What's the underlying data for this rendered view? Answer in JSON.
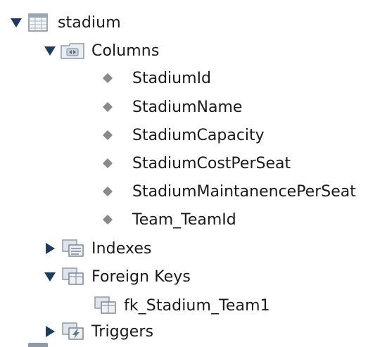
{
  "table": {
    "name": "stadium",
    "icon": "table-icon",
    "expanded": true
  },
  "groups": {
    "columns": {
      "label": "Columns",
      "icon": "folder-columns-icon",
      "expanded": true
    },
    "indexes": {
      "label": "Indexes",
      "icon": "indexes-icon",
      "expanded": false
    },
    "foreign_keys": {
      "label": "Foreign Keys",
      "icon": "foreign-keys-icon",
      "expanded": true
    },
    "triggers": {
      "label": "Triggers",
      "icon": "triggers-icon",
      "expanded": false
    }
  },
  "columns": [
    "StadiumId",
    "StadiumName",
    "StadiumCapacity",
    "StadiumCostPerSeat",
    "StadiumMaintanencePerSeat",
    "Team_TeamId"
  ],
  "foreign_keys": [
    {
      "name": "fk_Stadium_Team1",
      "icon": "foreign-key-icon"
    }
  ],
  "colors": {
    "arrow": "#1f3a5a",
    "column_marker": "#8a8a8a",
    "icon_gray": "#8f9aa6"
  }
}
